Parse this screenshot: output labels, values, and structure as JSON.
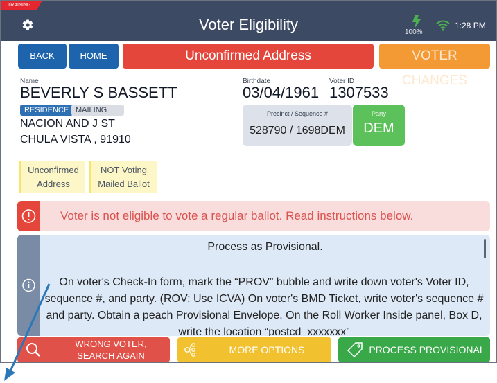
{
  "header": {
    "training_ribbon": "TRAINING",
    "title": "Voter Eligibility",
    "battery": "100%",
    "time": "1:28 PM",
    "icons": [
      "gear-icon",
      "battery-charging-icon",
      "wifi-icon"
    ]
  },
  "nav": {
    "back": "BACK",
    "home": "HOME",
    "status": "Unconfirmed Address",
    "voter_changes": "VOTER CHANGES"
  },
  "voter": {
    "name_label": "Name",
    "name": "BEVERLY S BASSETT",
    "birthdate_label": "Birthdate",
    "birthdate": "03/04/1961",
    "voter_id_label": "Voter ID",
    "voter_id": "1307533",
    "residence_tag": "RESIDENCE",
    "mailing_tag": "MAILING",
    "address_line1": "NACION AND J ST",
    "address_line2": "CHULA VISTA , 91910",
    "precinct_label": "Precinct / Sequence #",
    "precinct": "528790 / 1698DEM",
    "party_label": "Party",
    "party": "DEM"
  },
  "chips": [
    {
      "line1": "Unconfirmed",
      "line2": "Address"
    },
    {
      "line1": "NOT Voting",
      "line2": "Mailed Ballot"
    }
  ],
  "alert": {
    "text": "Voter is not eligible to vote a regular ballot.  Read instructions below."
  },
  "instructions": {
    "heading": "Process as Provisional.",
    "body": "On voter's Check-In form, mark the “PROV” bubble and write down voter's Voter ID, sequence #, and party. (ROV: Use ICVA) On voter's BMD Ticket, write voter's sequence # and party. Obtain a peach Provisional Envelope. On the Roll Worker Inside panel, Box D, write the location “postcd_xxxxxxx”"
  },
  "actions": {
    "wrong_voter_line1": "WRONG VOTER,",
    "wrong_voter_line2": "SEARCH AGAIN",
    "more_options": "MORE OPTIONS",
    "process_provisional": "PROCESS PROVISIONAL"
  },
  "colors": {
    "header": "#3d4a64",
    "nav_blue": "#1e64ac",
    "status_red": "#e5463b",
    "changes_orange": "#f39a34",
    "party_green": "#5cc15a",
    "more_yellow": "#f2c130",
    "provisional_green": "#38a848",
    "annotation_arrow": "#2a78b8"
  }
}
